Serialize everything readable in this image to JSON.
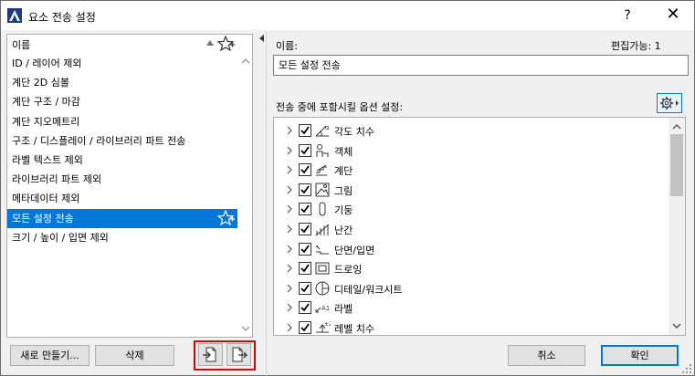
{
  "window": {
    "title": "요소 전송 설정",
    "help_label": "?",
    "close_label": "✕"
  },
  "left_list": {
    "header": "이름",
    "items": [
      {
        "label": "ID / 레이어 제외",
        "selected": false,
        "favorite": false
      },
      {
        "label": "계단 2D 심볼",
        "selected": false,
        "favorite": false
      },
      {
        "label": "계단 구조 / 마감",
        "selected": false,
        "favorite": false
      },
      {
        "label": "계단 지오메트리",
        "selected": false,
        "favorite": false
      },
      {
        "label": "구조 / 디스플레이 / 라이브러리 파트 전송",
        "selected": false,
        "favorite": false
      },
      {
        "label": "라벨 텍스트 제외",
        "selected": false,
        "favorite": false
      },
      {
        "label": "라이브러리 파트 제외",
        "selected": false,
        "favorite": false
      },
      {
        "label": "메타데이터 제외",
        "selected": false,
        "favorite": false
      },
      {
        "label": "모든 설정 전송",
        "selected": true,
        "favorite": true
      },
      {
        "label": "크기 / 높이 / 입면 제외",
        "selected": false,
        "favorite": false
      }
    ]
  },
  "buttons": {
    "new": "새로 만들기...",
    "delete": "삭제",
    "cancel": "취소",
    "ok": "확인"
  },
  "right": {
    "name_label": "이름:",
    "edit_label": "편집가능: 1",
    "name_value": "모든 설정 전송",
    "options_label": "전송 중에 포함시킬 옵션 설정:"
  },
  "tree_items": [
    {
      "label": "각도 치수",
      "icon": "angle-dimension-icon",
      "checked": true
    },
    {
      "label": "객체",
      "icon": "object-icon",
      "checked": true
    },
    {
      "label": "계단",
      "icon": "stair-icon",
      "checked": true
    },
    {
      "label": "그림",
      "icon": "picture-icon",
      "checked": true
    },
    {
      "label": "기둥",
      "icon": "column-icon",
      "checked": true
    },
    {
      "label": "난간",
      "icon": "railing-icon",
      "checked": true
    },
    {
      "label": "단면/입면",
      "icon": "section-icon",
      "checked": true
    },
    {
      "label": "드로잉",
      "icon": "drawing-icon",
      "checked": true
    },
    {
      "label": "디테일/워크시트",
      "icon": "detail-icon",
      "checked": true
    },
    {
      "label": "라벨",
      "icon": "label-icon",
      "checked": true
    },
    {
      "label": "레벨 치수",
      "icon": "level-dimension-icon",
      "checked": true
    }
  ],
  "colors": {
    "selection": "#0078d7",
    "highlight_box": "#e00000"
  }
}
